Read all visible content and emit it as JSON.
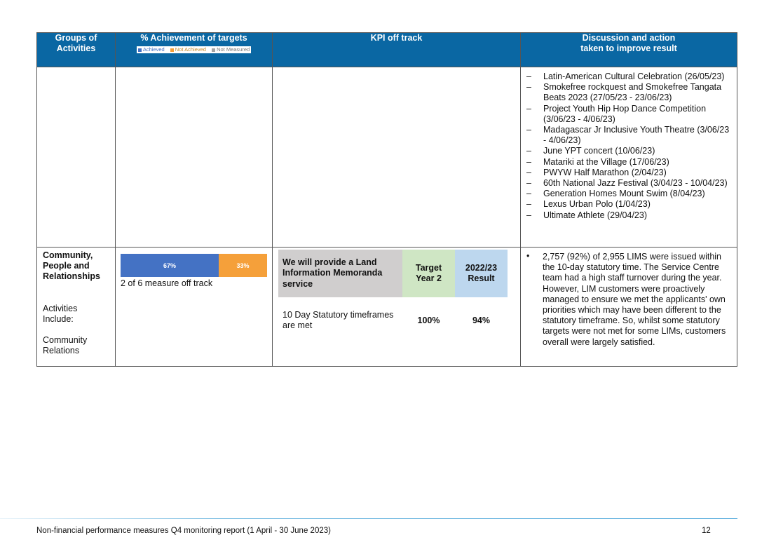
{
  "table": {
    "headers": {
      "groups": "Groups of Activities",
      "achievement": "% Achievement of targets",
      "kpi": "KPI off track",
      "discussion": "Discussion and action taken to improve result"
    },
    "legend": {
      "achieved": "Achieved",
      "not_achieved": "Not Achieved",
      "not_measured": "Not Measured"
    },
    "events": [
      "Latin-American Cultural Celebration (26/05/23)",
      "Smokefree rockquest and Smokefree Tangata Beats 2023 (27/05/23 - 23/06/23)",
      "Project Youth Hip Hop Dance Competition (3/06/23 - 4/06/23)",
      "Madagascar Jr Inclusive Youth Theatre (3/06/23 - 4/06/23)",
      "June YPT concert (10/06/23)",
      "Matariki at the Village (17/06/23)",
      "PWYW Half Marathon (2/04/23)",
      "60th National Jazz Festival (3/04/23 - 10/04/23)",
      "Generation Homes Mount Swim (8/04/23)",
      "Lexus Urban Polo (1/04/23)",
      "Ultimate Athlete (29/04/23)"
    ],
    "group": {
      "name": "Community, People and Relationships",
      "activities_label": "Activities Include:",
      "activity": "Community Relations"
    },
    "achievement": {
      "achieved_pct": 67,
      "not_achieved_pct": 33,
      "achieved_label": "67%",
      "not_achieved_label": "33%",
      "caption": "2 of 6 measure off track"
    },
    "kpi": {
      "service": "We will provide a Land Information Memoranda service",
      "target_header": "Target Year 2",
      "result_header": "2022/23 Result",
      "measure": "10 Day Statutory timeframes are met",
      "target": "100%",
      "result": "94%"
    },
    "discussion": "2,757 (92%) of 2,955 LIMS were issued within the 10-day statutory time. The Service Centre team had a high staff turnover during the year. However, LIM customers were proactively managed to ensure we met the applicants' own priorities which may have been different to the statutory timeframe. So, whilst some statutory targets were not met for some LIMs, customers overall were largely satisfied."
  },
  "footer": {
    "text": "Non-financial performance measures Q4 monitoring report (1 April - 30 June 2023)",
    "page": "12"
  },
  "colors": {
    "header_bg": "#0a67a3",
    "achieved": "#4472c4",
    "not_achieved": "#f5a03a",
    "not_measured": "#a5a5a5",
    "kpi_service_bg": "#d0cece",
    "kpi_target_bg": "#cfe6c4",
    "kpi_result_bg": "#bdd7ee"
  }
}
